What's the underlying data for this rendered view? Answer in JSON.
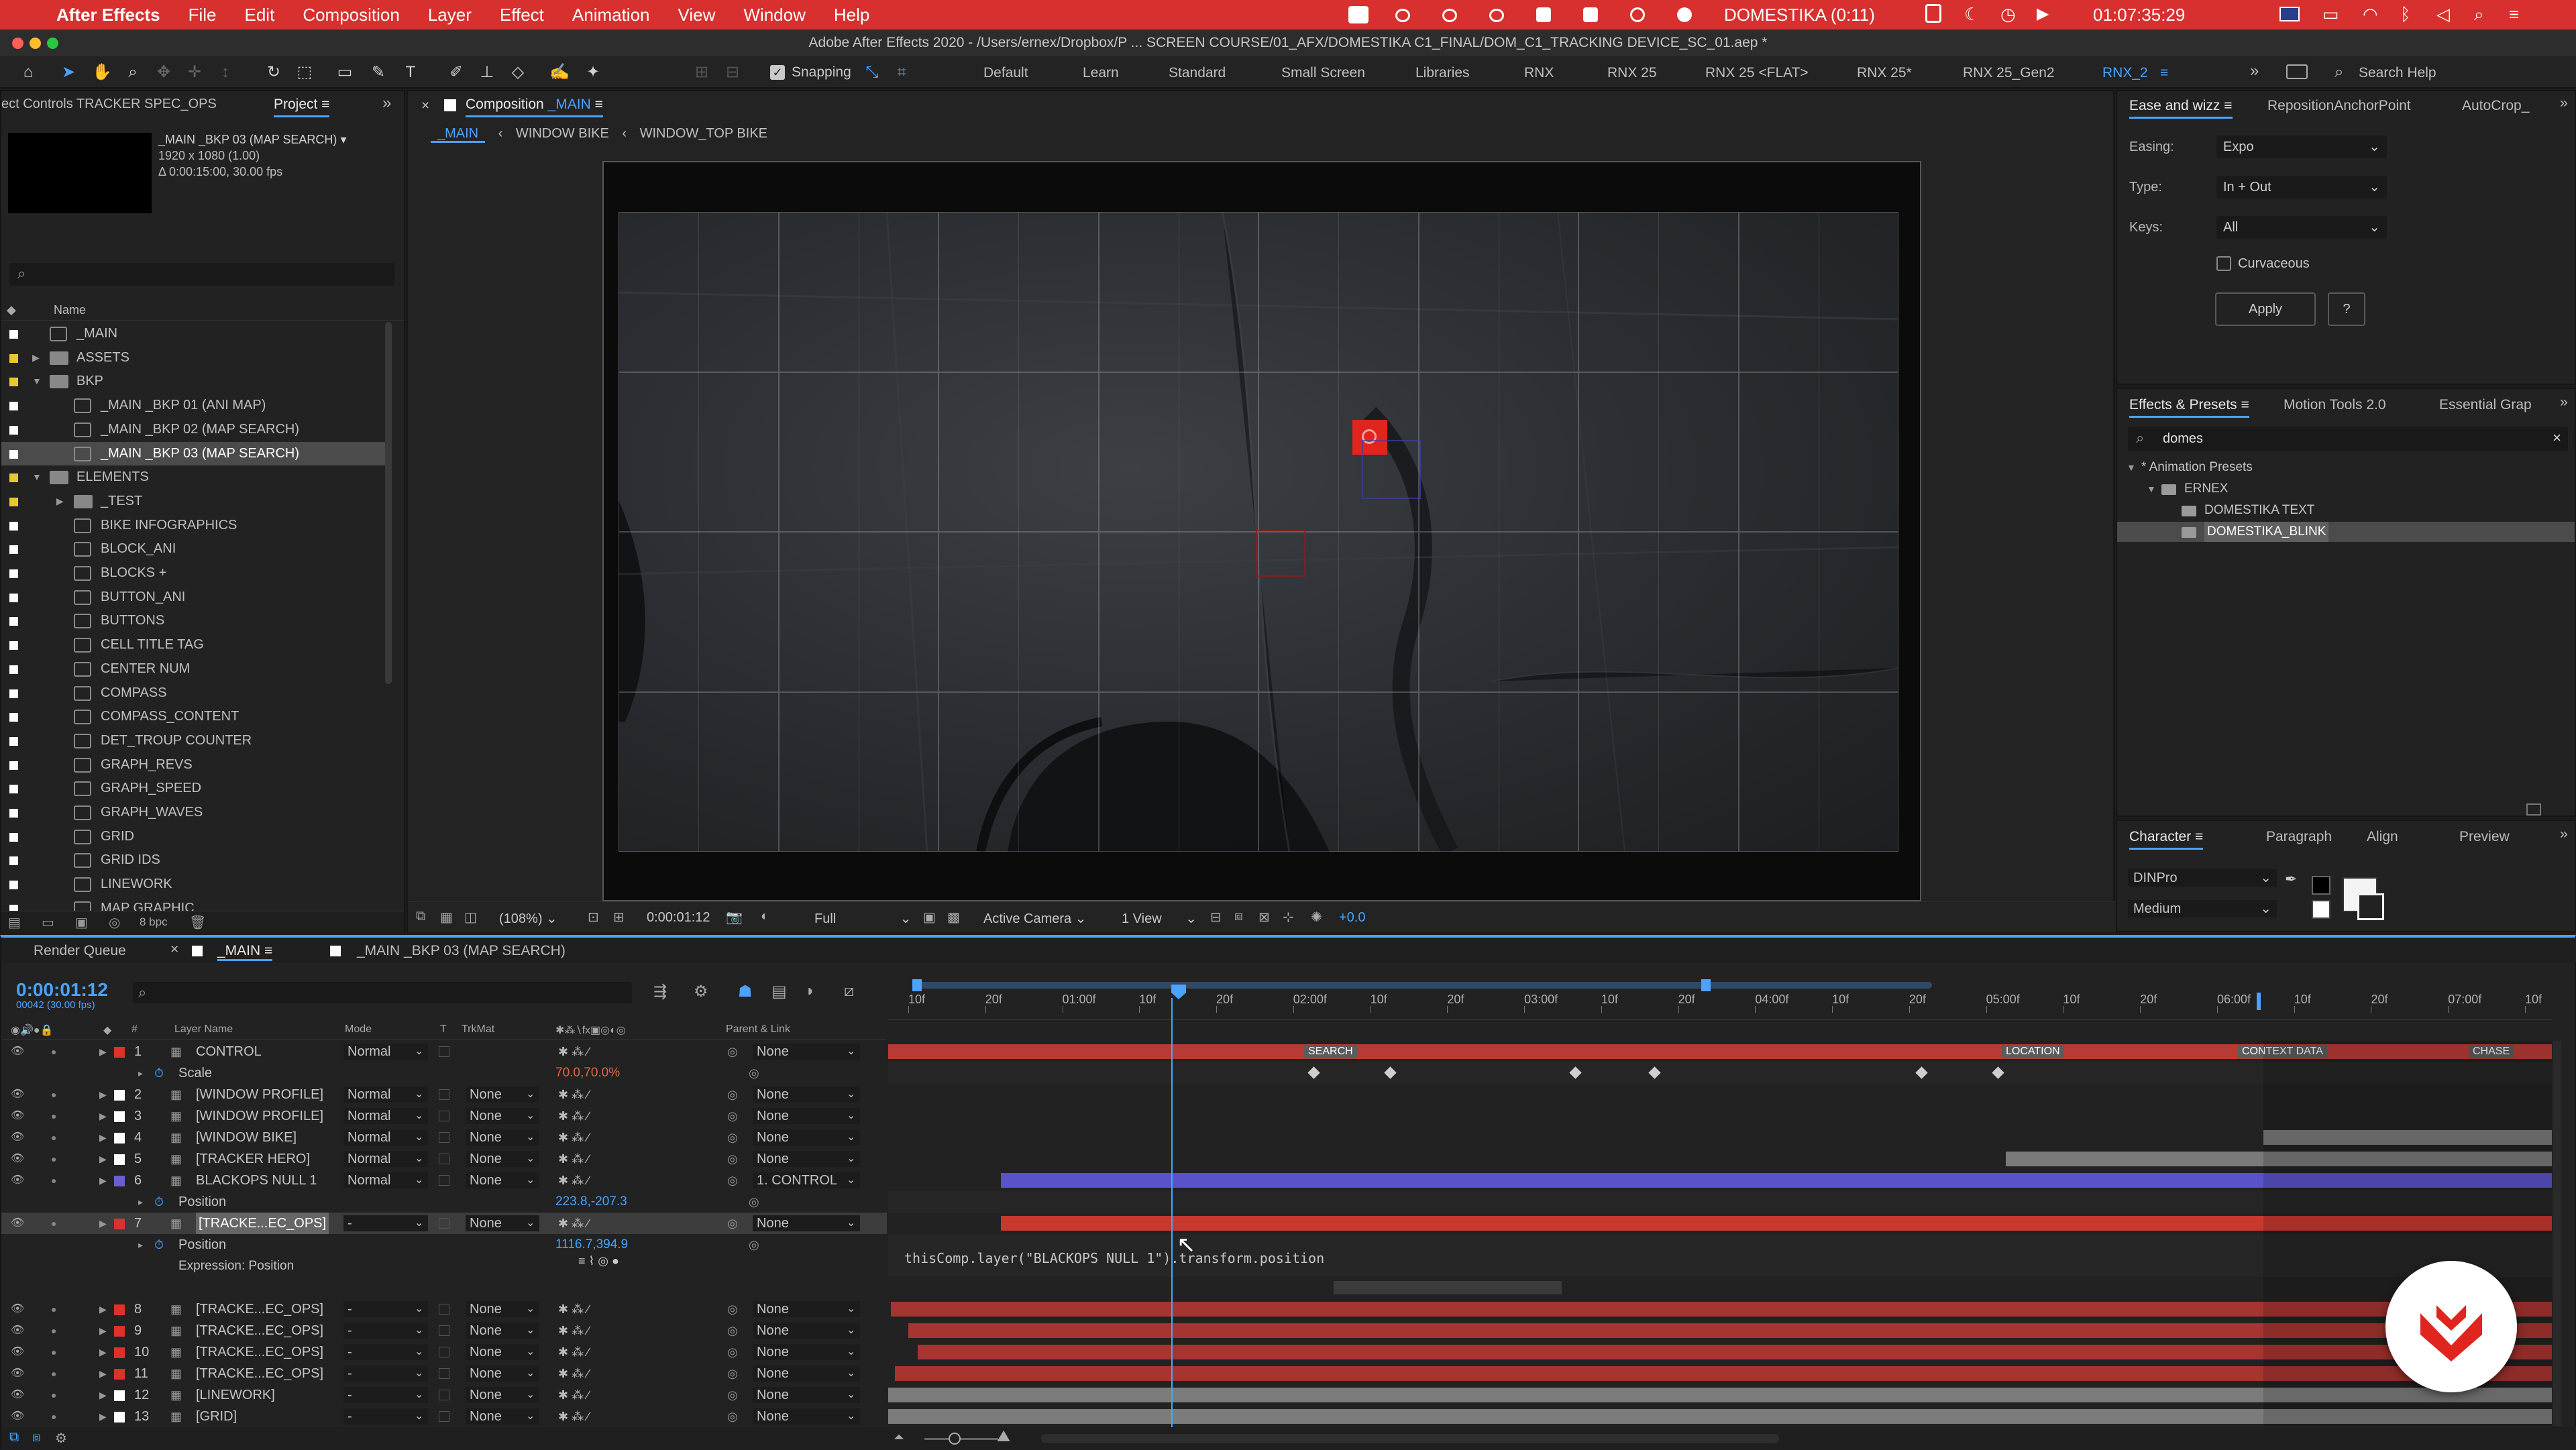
{
  "menubar": {
    "app_name": "After Effects",
    "items": [
      "File",
      "Edit",
      "Composition",
      "Layer",
      "Effect",
      "Animation",
      "View",
      "Window",
      "Help"
    ],
    "domestika": "DOMESTIKA (0:11)",
    "clock": "01:07:35:29"
  },
  "titlebar": "Adobe After Effects 2020 - /Users/ernex/Dropbox/P ... SCREEN COURSE/01_AFX/DOMESTIKA C1_FINAL/DOM_C1_TRACKING DEVICE_SC_01.aep *",
  "toolbar": {
    "snapping": "Snapping",
    "workspaces": [
      "Default",
      "Learn",
      "Standard",
      "Small Screen",
      "Libraries",
      "RNX",
      "RNX 25",
      "RNX 25 <FLAT>",
      "RNX 25*",
      "RNX 25_Gen2",
      "RNX_2"
    ],
    "active_workspace": "RNX_2",
    "search_help": "Search Help"
  },
  "effect_controls_tab": "ect Controls TRACKER SPEC_OPS",
  "project": {
    "tab": "Project",
    "thumb_name": "_MAIN _BKP 03 (MAP SEARCH)",
    "thumb_info1": "1920 x 1080 (1.00)",
    "thumb_info2": "Δ 0:00:15:00, 30.00 fps",
    "col_name": "Name",
    "bpc": "8 bpc",
    "items": [
      {
        "label": "_MAIN",
        "type": "comp",
        "indent": 0,
        "color": "#ffffff"
      },
      {
        "label": "ASSETS",
        "type": "folder",
        "indent": 0,
        "color": "#e8c82e",
        "arrow": "▶"
      },
      {
        "label": "BKP",
        "type": "folder",
        "indent": 0,
        "color": "#e8c82e",
        "arrow": "▼"
      },
      {
        "label": "_MAIN _BKP 01 (ANI MAP)",
        "type": "comp",
        "indent": 1,
        "color": "#ffffff"
      },
      {
        "label": "_MAIN _BKP 02 (MAP SEARCH)",
        "type": "comp",
        "indent": 1,
        "color": "#ffffff"
      },
      {
        "label": "_MAIN _BKP 03 (MAP SEARCH)",
        "type": "comp",
        "indent": 1,
        "color": "#ffffff",
        "selected": true
      },
      {
        "label": "ELEMENTS",
        "type": "folder",
        "indent": 0,
        "color": "#e8c82e",
        "arrow": "▼"
      },
      {
        "label": "_TEST",
        "type": "folder",
        "indent": 1,
        "color": "#e8c82e",
        "arrow": "▶"
      },
      {
        "label": "BIKE INFOGRAPHICS",
        "type": "comp",
        "indent": 1,
        "color": "#ffffff"
      },
      {
        "label": "BLOCK_ANI",
        "type": "comp",
        "indent": 1,
        "color": "#ffffff"
      },
      {
        "label": "BLOCKS +",
        "type": "comp",
        "indent": 1,
        "color": "#ffffff"
      },
      {
        "label": "BUTTON_ANI",
        "type": "comp",
        "indent": 1,
        "color": "#ffffff"
      },
      {
        "label": "BUTTONS",
        "type": "comp",
        "indent": 1,
        "color": "#ffffff"
      },
      {
        "label": "CELL TITLE TAG",
        "type": "comp",
        "indent": 1,
        "color": "#ffffff"
      },
      {
        "label": "CENTER NUM",
        "type": "comp",
        "indent": 1,
        "color": "#ffffff"
      },
      {
        "label": "COMPASS",
        "type": "comp",
        "indent": 1,
        "color": "#ffffff"
      },
      {
        "label": "COMPASS_CONTENT",
        "type": "comp",
        "indent": 1,
        "color": "#ffffff"
      },
      {
        "label": "DET_TROUP COUNTER",
        "type": "comp",
        "indent": 1,
        "color": "#ffffff"
      },
      {
        "label": "GRAPH_REVS",
        "type": "comp",
        "indent": 1,
        "color": "#ffffff"
      },
      {
        "label": "GRAPH_SPEED",
        "type": "comp",
        "indent": 1,
        "color": "#ffffff"
      },
      {
        "label": "GRAPH_WAVES",
        "type": "comp",
        "indent": 1,
        "color": "#ffffff"
      },
      {
        "label": "GRID",
        "type": "comp",
        "indent": 1,
        "color": "#ffffff"
      },
      {
        "label": "GRID IDS",
        "type": "comp",
        "indent": 1,
        "color": "#ffffff"
      },
      {
        "label": "LINEWORK",
        "type": "comp",
        "indent": 1,
        "color": "#ffffff"
      },
      {
        "label": "MAP GRAPHIC",
        "type": "comp",
        "indent": 1,
        "color": "#ffffff"
      }
    ]
  },
  "composition": {
    "tab": "Composition",
    "tab_name": "_MAIN",
    "breadcrumbs": [
      "_MAIN",
      "WINDOW BIKE",
      "WINDOW_TOP BIKE"
    ],
    "zoom": "(108%)",
    "timecode": "0:00:01:12",
    "resolution": "Full",
    "camera": "Active Camera",
    "views": "1 View",
    "exposure": "+0.0"
  },
  "ease": {
    "tab1": "Ease and wizz",
    "tab2": "RepositionAnchorPoint",
    "tab3": "AutoCrop_",
    "easing_label": "Easing:",
    "easing_value": "Expo",
    "type_label": "Type:",
    "type_value": "In + Out",
    "keys_label": "Keys:",
    "keys_value": "All",
    "curvaceous": "Curvaceous",
    "apply": "Apply",
    "help": "?"
  },
  "effects": {
    "tab1": "Effects & Presets",
    "tab2": "Motion Tools 2.0",
    "tab3": "Essential Grap",
    "search": "domes",
    "tree": [
      {
        "label": "* Animation Presets",
        "indent": 0,
        "arrow": "▼"
      },
      {
        "label": "ERNEX",
        "indent": 1,
        "arrow": "▼"
      },
      {
        "label": "DOMESTIKA TEXT",
        "indent": 2
      },
      {
        "label": "DOMESTIKA_BLINK",
        "indent": 2,
        "selected": true
      }
    ]
  },
  "character": {
    "tab1": "Character",
    "tab2": "Paragraph",
    "tab3": "Align",
    "tab4": "Preview",
    "font": "DINPro",
    "style": "Medium"
  },
  "timeline": {
    "tab_render": "Render Queue",
    "tab_main": "_MAIN",
    "tab_bkp": "_MAIN _BKP 03 (MAP SEARCH)",
    "timecode": "0:00:01:12",
    "frames": "00042 (30.00 fps)",
    "headers": {
      "num": "#",
      "layer": "Layer Name",
      "mode": "Mode",
      "t": "T",
      "trkmat": "TrkMat",
      "parent": "Parent & Link"
    },
    "ruler": [
      "10f",
      "20f",
      "01:00f",
      "10f",
      "20f",
      "02:00f",
      "10f",
      "20f",
      "03:00f",
      "10f",
      "20f",
      "04:00f",
      "10f",
      "20f",
      "05:00f",
      "10f",
      "20f",
      "06:00f",
      "10f",
      "20f",
      "07:00f",
      "10f"
    ],
    "markers": [
      "SEARCH",
      "LOCATION",
      "CONTEXT DATA",
      "CHASE"
    ],
    "layers": [
      {
        "num": "1",
        "name": "CONTROL",
        "mode": "Normal",
        "trkmat": "",
        "parent": "None",
        "color": "#d9332b",
        "vis": true,
        "expanded": true,
        "bar": "#b83a35"
      },
      {
        "num": "",
        "name": "Scale",
        "prop": true,
        "value": "70.0,70.0%",
        "value_color": "#e06a40"
      },
      {
        "num": "2",
        "name": "[WINDOW PROFILE]",
        "mode": "Normal",
        "trkmat": "None",
        "parent": "None",
        "color": "#ffffff",
        "vis": true
      },
      {
        "num": "3",
        "name": "[WINDOW PROFILE]",
        "mode": "Normal",
        "trkmat": "None",
        "parent": "None",
        "color": "#ffffff",
        "vis": true
      },
      {
        "num": "4",
        "name": "[WINDOW BIKE]",
        "mode": "Normal",
        "trkmat": "None",
        "parent": "None",
        "color": "#ffffff",
        "vis": true
      },
      {
        "num": "5",
        "name": "[TRACKER HERO]",
        "mode": "Normal",
        "trkmat": "None",
        "parent": "None",
        "color": "#ffffff",
        "vis": true
      },
      {
        "num": "6",
        "name": "BLACKOPS NULL 1",
        "mode": "Normal",
        "trkmat": "None",
        "parent": "1. CONTROL",
        "color": "#6a5fd0",
        "vis": true,
        "expanded": true
      },
      {
        "num": "",
        "name": "Position",
        "prop": true,
        "value": "223.8,-207.3",
        "value_color": "#4aa3ff"
      },
      {
        "num": "7",
        "name": "[TRACKE...EC_OPS]",
        "mode": "-",
        "trkmat": "None",
        "parent": "None",
        "color": "#d9332b",
        "vis": true,
        "expanded": true,
        "selected": true
      },
      {
        "num": "",
        "name": "Position",
        "prop": true,
        "value": "1116.7,394.9",
        "value_color": "#4aa3ff"
      },
      {
        "num": "",
        "name": "Expression: Position",
        "expr": true
      },
      {
        "num": "",
        "name": "",
        "blank": true
      },
      {
        "num": "8",
        "name": "[TRACKE...EC_OPS]",
        "mode": "-",
        "trkmat": "None",
        "parent": "None",
        "color": "#d9332b",
        "vis": true
      },
      {
        "num": "9",
        "name": "[TRACKE...EC_OPS]",
        "mode": "-",
        "trkmat": "None",
        "parent": "None",
        "color": "#d9332b",
        "vis": true
      },
      {
        "num": "10",
        "name": "[TRACKE...EC_OPS]",
        "mode": "-",
        "trkmat": "None",
        "parent": "None",
        "color": "#d9332b",
        "vis": true
      },
      {
        "num": "11",
        "name": "[TRACKE...EC_OPS]",
        "mode": "-",
        "trkmat": "None",
        "parent": "None",
        "color": "#d9332b",
        "vis": true
      },
      {
        "num": "12",
        "name": "[LINEWORK]",
        "mode": "-",
        "trkmat": "None",
        "parent": "None",
        "color": "#ffffff",
        "vis": true
      },
      {
        "num": "13",
        "name": "[GRID]",
        "mode": "-",
        "trkmat": "None",
        "parent": "None",
        "color": "#ffffff",
        "vis": true
      }
    ],
    "expression": "thisComp.layer(\"BLACKOPS NULL 1\").transform.position"
  },
  "colors": {
    "accent": "#4aa3ff",
    "brand_red": "#d7302f",
    "timeline_red": "#c8382f",
    "null_blue": "#5a52c8"
  }
}
